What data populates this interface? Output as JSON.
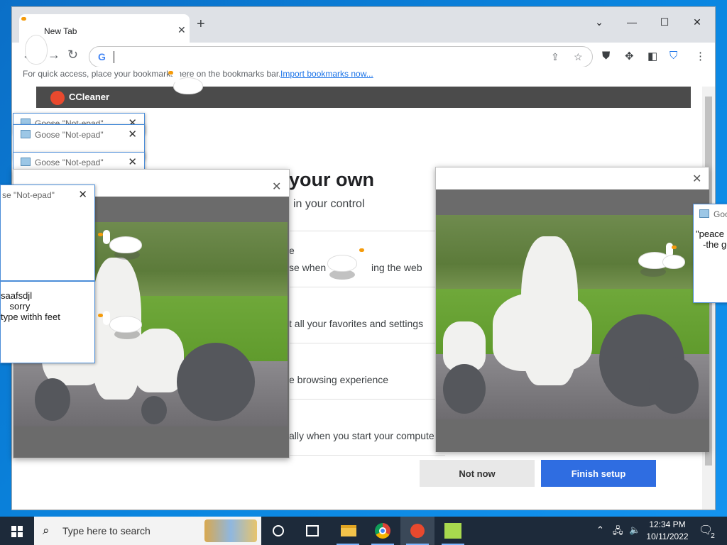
{
  "browser": {
    "tab_title": "New Tab",
    "new_tab": "+",
    "window_controls": {
      "dropdown": "⌄",
      "minimize": "—",
      "maximize": "☐",
      "close": "✕"
    },
    "omnibox_logo": "G",
    "bookmark_hint": "For quick access, place your bookmarks here on the bookmarks bar.",
    "import_bookmarks": "Import bookmarks now..."
  },
  "ccleaner": {
    "brand": "CCleaner",
    "setup_title": "your own",
    "setup_subtitle": "in your control",
    "rows": [
      "e",
      "se when",
      "ing the web",
      "t all your favorites and settings",
      "e browsing experience",
      "ally when you start your compute"
    ],
    "not_now": "Not now",
    "finish_setup": "Finish setup"
  },
  "notepads": [
    {
      "title": "Goose \"Not-epad\""
    },
    {
      "title": "Goose \"Not-epad\""
    },
    {
      "title": "Goose \"Not-epad\""
    },
    {
      "title": "se \"Not-epad\"",
      "lines": [
        "saafsdjl",
        "sorry",
        "type withh feet"
      ]
    },
    {
      "title": "Goo",
      "lines": [
        "\"peace",
        "-the go"
      ]
    }
  ],
  "taskbar": {
    "search_placeholder": "Type here to search",
    "time": "12:34 PM",
    "date": "10/11/2022",
    "notification_count": "2"
  },
  "colors": {
    "accent_blue": "#2f6de1",
    "desktop_blue": "#0a78d4",
    "taskbar": "#1d2a3a",
    "goose_beak": "#f59b0b"
  }
}
